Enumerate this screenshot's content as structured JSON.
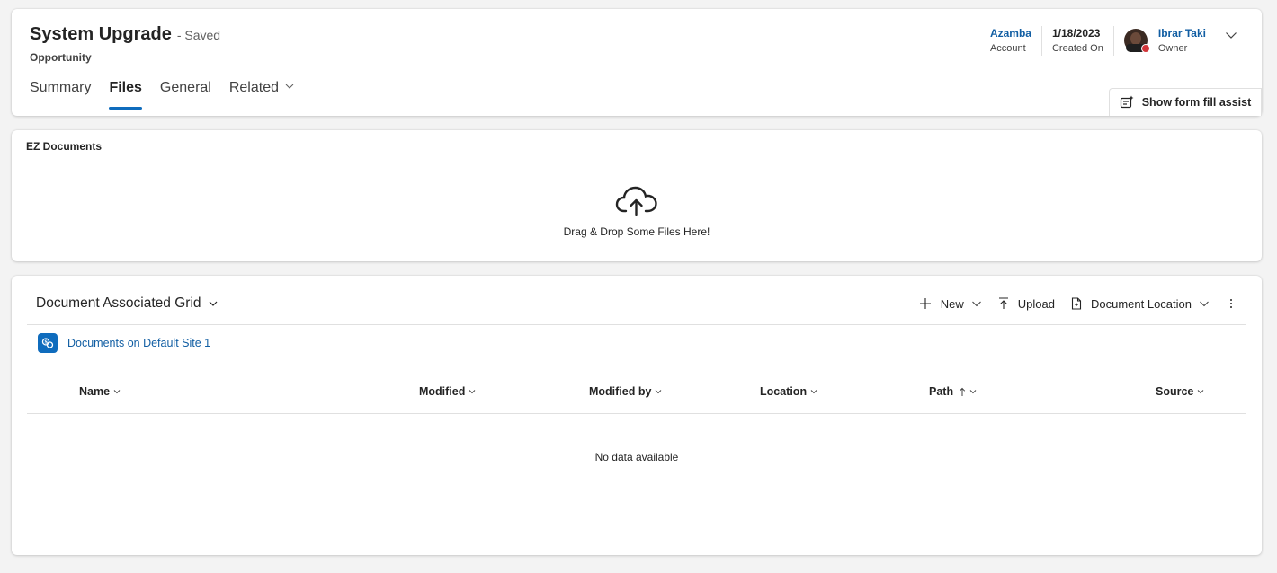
{
  "record": {
    "title": "System Upgrade",
    "saved_status": "- Saved",
    "entity": "Opportunity",
    "tabs": [
      {
        "label": "Summary"
      },
      {
        "label": "Files"
      },
      {
        "label": "General"
      },
      {
        "label": "Related"
      }
    ],
    "active_tab": "Files"
  },
  "header_fields": {
    "account_value": "Azamba",
    "account_label": "Account",
    "created_value": "1/18/2023",
    "created_label": "Created On",
    "owner_value": "Ibrar Taki",
    "owner_label": "Owner",
    "presence_color": "#d13438"
  },
  "form_fill": {
    "label": "Show form fill assist"
  },
  "ez_documents": {
    "title": "EZ Documents",
    "drop_text": "Drag & Drop Some Files Here!",
    "icon": "cloud-upload-icon"
  },
  "grid": {
    "title": "Document Associated Grid",
    "commands": {
      "new": "New",
      "upload": "Upload",
      "location": "Document Location"
    },
    "site_link": "Documents on Default Site 1",
    "columns": {
      "name": "Name",
      "modified": "Modified",
      "modified_by": "Modified by",
      "location": "Location",
      "path": "Path",
      "source": "Source"
    },
    "sorted_column": "Path",
    "empty_text": "No data available"
  },
  "colors": {
    "accent": "#0f6cbd",
    "link": "#115ea3",
    "background": "#f3f3f3"
  }
}
